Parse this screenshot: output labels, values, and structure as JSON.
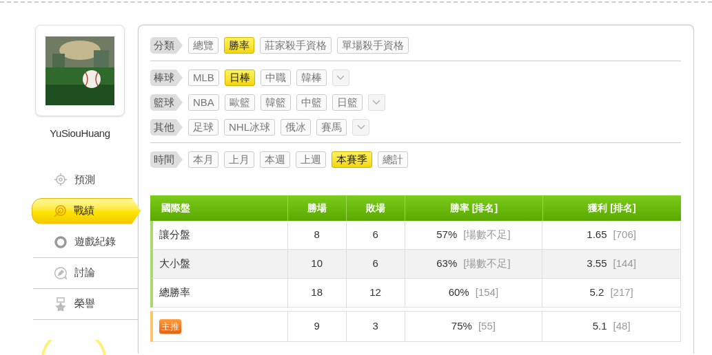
{
  "profile": {
    "username": "YuSiouHuang"
  },
  "menu": [
    {
      "label": "預測",
      "selected": false
    },
    {
      "label": "戰績",
      "selected": true
    },
    {
      "label": "遊戲紀錄",
      "selected": false
    },
    {
      "label": "討論",
      "selected": false
    },
    {
      "label": "榮譽",
      "selected": false
    }
  ],
  "filter_groups": [
    [
      {
        "label": "分類",
        "more": false,
        "options": [
          {
            "label": "總覽",
            "selected": false
          },
          {
            "label": "勝率",
            "selected": true
          },
          {
            "label": "莊家殺手資格",
            "selected": false
          },
          {
            "label": "單場殺手資格",
            "selected": false
          }
        ]
      }
    ],
    [
      {
        "label": "棒球",
        "more": true,
        "options": [
          {
            "label": "MLB",
            "selected": false
          },
          {
            "label": "日棒",
            "selected": true
          },
          {
            "label": "中職",
            "selected": false
          },
          {
            "label": "韓棒",
            "selected": false
          }
        ]
      },
      {
        "label": "籃球",
        "more": true,
        "options": [
          {
            "label": "NBA",
            "selected": false
          },
          {
            "label": "歐籃",
            "selected": false
          },
          {
            "label": "韓籃",
            "selected": false
          },
          {
            "label": "中籃",
            "selected": false
          },
          {
            "label": "日籃",
            "selected": false
          }
        ]
      },
      {
        "label": "其他",
        "more": true,
        "options": [
          {
            "label": "足球",
            "selected": false
          },
          {
            "label": "NHL冰球",
            "selected": false
          },
          {
            "label": "俄冰",
            "selected": false
          },
          {
            "label": "賽馬",
            "selected": false
          }
        ]
      }
    ],
    [
      {
        "label": "時間",
        "more": false,
        "options": [
          {
            "label": "本月",
            "selected": false
          },
          {
            "label": "上月",
            "selected": false
          },
          {
            "label": "本週",
            "selected": false
          },
          {
            "label": "上週",
            "selected": false
          },
          {
            "label": "本賽季",
            "selected": true
          },
          {
            "label": "總計",
            "selected": false
          }
        ]
      }
    ]
  ],
  "table": {
    "columns": [
      "國際盤",
      "勝場",
      "敗場",
      "勝率 [排名]",
      "獲利 [排名]"
    ],
    "rows": [
      {
        "kind": "normal",
        "name": "讓分盤",
        "wins": "8",
        "losses": "6",
        "rate": "57%",
        "rate_rank": "[場數不足]",
        "profit": "1.65",
        "profit_rank": "[706]"
      },
      {
        "kind": "normal",
        "name": "大小盤",
        "wins": "10",
        "losses": "6",
        "rate": "63%",
        "rate_rank": "[場數不足]",
        "profit": "3.55",
        "profit_rank": "[144]"
      },
      {
        "kind": "normal",
        "name": "總勝率",
        "wins": "18",
        "losses": "12",
        "rate": "60%",
        "rate_rank": "[154]",
        "profit": "5.2",
        "profit_rank": "[217]"
      },
      {
        "kind": "featured",
        "name": "主推",
        "wins": "9",
        "losses": "3",
        "rate": "75%",
        "rate_rank": "[55]",
        "profit": "5.1",
        "profit_rank": "[48]"
      }
    ]
  }
}
